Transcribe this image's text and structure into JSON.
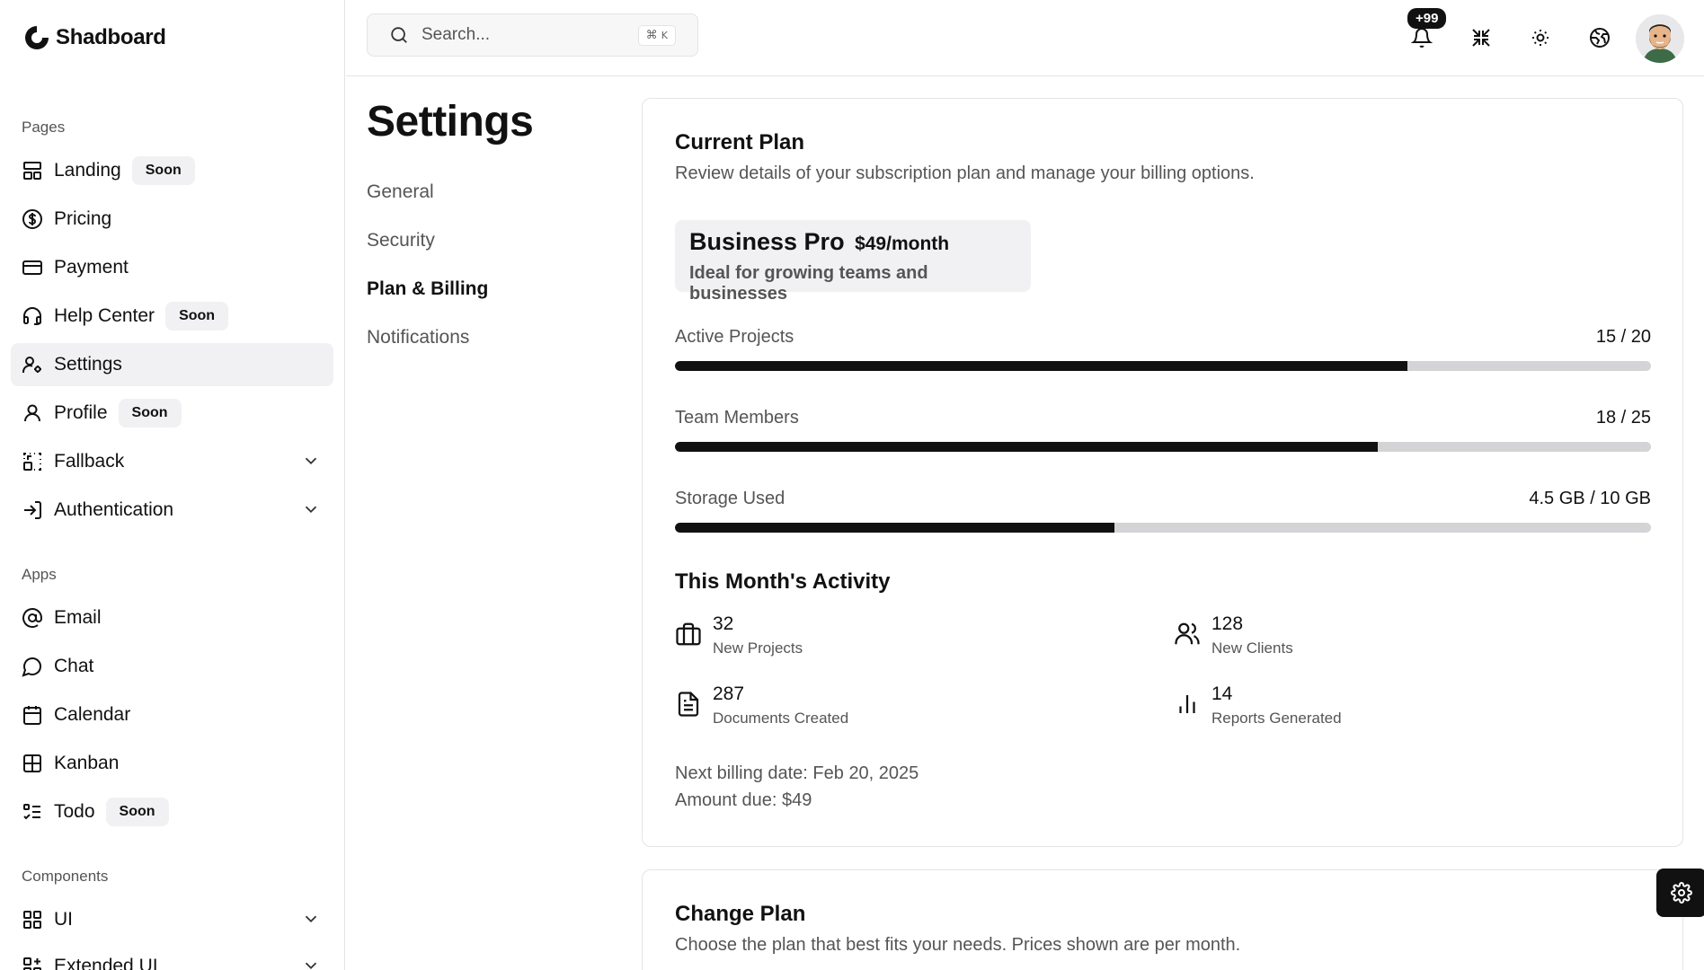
{
  "brand": {
    "name": "Shadboard"
  },
  "sidebar": {
    "groups": [
      {
        "label": "Pages"
      },
      {
        "label": "Apps"
      },
      {
        "label": "Components"
      }
    ],
    "items": [
      {
        "label": "Landing",
        "badge": "Soon",
        "icon": "layout-icon"
      },
      {
        "label": "Pricing",
        "icon": "dollar-circle-icon"
      },
      {
        "label": "Payment",
        "icon": "credit-card-icon"
      },
      {
        "label": "Help Center",
        "badge": "Soon",
        "icon": "headset-icon"
      },
      {
        "label": "Settings",
        "icon": "user-cog-icon",
        "active": true
      },
      {
        "label": "Profile",
        "badge": "Soon",
        "icon": "user-icon"
      },
      {
        "label": "Fallback",
        "icon": "fallback-icon",
        "expandable": true
      },
      {
        "label": "Authentication",
        "icon": "log-in-icon",
        "expandable": true
      },
      {
        "label": "Email",
        "icon": "at-sign-icon"
      },
      {
        "label": "Chat",
        "icon": "message-circle-icon"
      },
      {
        "label": "Calendar",
        "icon": "calendar-icon"
      },
      {
        "label": "Kanban",
        "icon": "kanban-grid-icon"
      },
      {
        "label": "Todo",
        "badge": "Soon",
        "icon": "list-todo-icon"
      },
      {
        "label": "UI",
        "icon": "grid-icon",
        "expandable": true
      },
      {
        "label": "Extended UI",
        "icon": "grid-plus-icon",
        "expandable": true
      }
    ]
  },
  "header": {
    "search": {
      "placeholder": "Search...",
      "shortcut_symbol": "⌘",
      "shortcut_key": "K"
    },
    "notifications": {
      "count": "+99"
    },
    "actions": [
      "bell-icon",
      "minimize-icon",
      "sun-icon",
      "globe-icon",
      "avatar"
    ]
  },
  "settings": {
    "title": "Settings",
    "nav": [
      {
        "label": "General"
      },
      {
        "label": "Security"
      },
      {
        "label": "Plan & Billing",
        "active": true
      },
      {
        "label": "Notifications"
      }
    ]
  },
  "current_plan": {
    "title": "Current Plan",
    "subtitle": "Review details of your subscription plan and manage your billing options.",
    "plan_name": "Business Pro",
    "plan_price": "$49/month",
    "plan_description": "Ideal for growing teams and businesses",
    "usage": [
      {
        "label": "Active Projects",
        "value": "15 / 20",
        "fraction": 0.75
      },
      {
        "label": "Team Members",
        "value": "18 / 25",
        "fraction": 0.72
      },
      {
        "label": "Storage Used",
        "value": "4.5 GB / 10 GB",
        "fraction": 0.45
      }
    ],
    "activity_title": "This Month's Activity",
    "activity": [
      {
        "value": "32",
        "label": "New Projects",
        "icon": "briefcase-icon"
      },
      {
        "value": "128",
        "label": "New Clients",
        "icon": "users-icon"
      },
      {
        "value": "287",
        "label": "Documents Created",
        "icon": "file-text-icon"
      },
      {
        "value": "14",
        "label": "Reports Generated",
        "icon": "bar-chart-icon"
      }
    ],
    "next_billing": "Next billing date: Feb 20, 2025",
    "amount_due": "Amount due: $49"
  },
  "change_plan": {
    "title": "Change Plan",
    "subtitle": "Choose the plan that best fits your needs. Prices shown are per month."
  }
}
